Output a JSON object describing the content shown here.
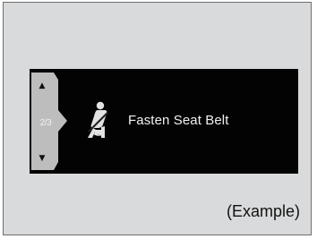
{
  "display": {
    "page_indicator": "2/3",
    "message": "Fasten Seat Belt",
    "icon": "seat-belt-reminder-icon",
    "scroll_up_icon": "up-triangle-icon",
    "scroll_down_icon": "down-triangle-icon"
  },
  "caption": "(Example)",
  "colors": {
    "background": "#d9dadb",
    "panel": "#030303",
    "text": "#f1f1f1"
  }
}
